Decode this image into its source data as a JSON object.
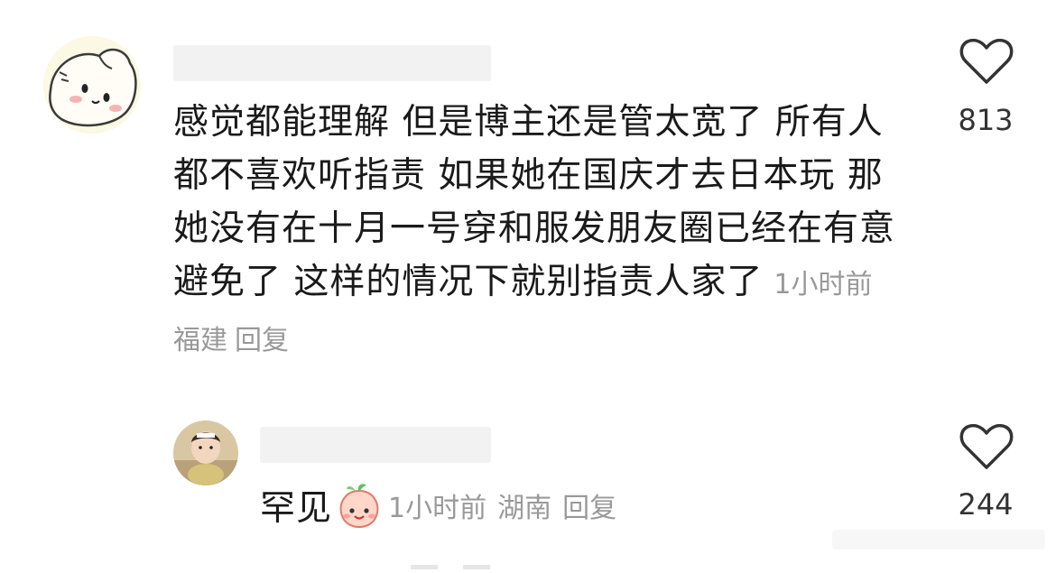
{
  "comments": [
    {
      "text": "感觉都能理解 但是博主还是管太宽了 所有人都不喜欢听指责 如果她在国庆才去日本玩 那她没有在十月一号穿和服发朋友圈已经在有意避免了 这样的情况下就别指责人家了",
      "time": "1小时前",
      "location": "福建",
      "reply_label": "回复",
      "likes": "813",
      "like_icon": "heart-outline-icon",
      "avatar_icon": "cartoon-avatar"
    },
    {
      "text": "罕见",
      "emoji_icon": "peach-smile-emoji",
      "time": "1小时前",
      "location": "湖南",
      "reply_label": "回复",
      "likes": "244",
      "like_icon": "heart-outline-icon",
      "avatar_icon": "child-photo-avatar"
    }
  ],
  "colors": {
    "text": "#1a1a1a",
    "meta": "#999999",
    "count": "#333333",
    "icon_stroke": "#333333"
  }
}
